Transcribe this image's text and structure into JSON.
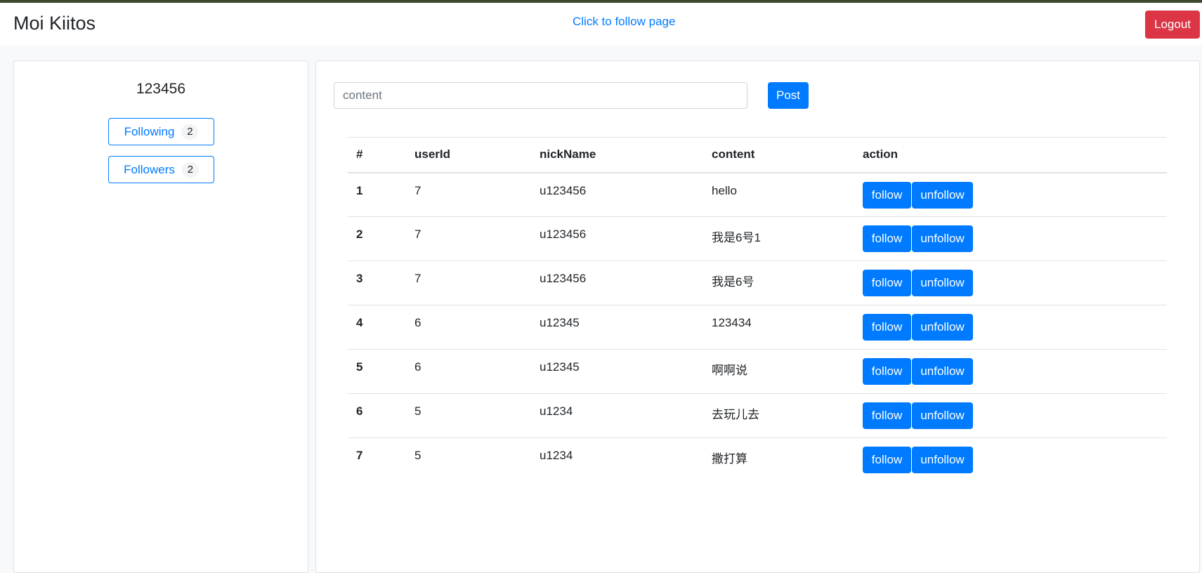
{
  "header": {
    "brand": "Moi Kiitos",
    "follow_link": "Click to follow page",
    "logout_label": "Logout"
  },
  "profile": {
    "username": "123456",
    "following_label": "Following",
    "following_count": "2",
    "followers_label": "Followers",
    "followers_count": "2"
  },
  "composer": {
    "placeholder": "content",
    "post_label": "Post"
  },
  "table": {
    "headers": [
      "#",
      "userId",
      "nickName",
      "content",
      "action"
    ],
    "follow_label": "follow",
    "unfollow_label": "unfollow",
    "rows": [
      {
        "num": "1",
        "userId": "7",
        "nickName": "u123456",
        "content": "hello"
      },
      {
        "num": "2",
        "userId": "7",
        "nickName": "u123456",
        "content": "我是6号1"
      },
      {
        "num": "3",
        "userId": "7",
        "nickName": "u123456",
        "content": "我是6号"
      },
      {
        "num": "4",
        "userId": "6",
        "nickName": "u12345",
        "content": "123434"
      },
      {
        "num": "5",
        "userId": "6",
        "nickName": "u12345",
        "content": "啊啊说"
      },
      {
        "num": "6",
        "userId": "5",
        "nickName": "u1234",
        "content": "去玩儿去"
      },
      {
        "num": "7",
        "userId": "5",
        "nickName": "u1234",
        "content": "撒打算"
      }
    ]
  }
}
